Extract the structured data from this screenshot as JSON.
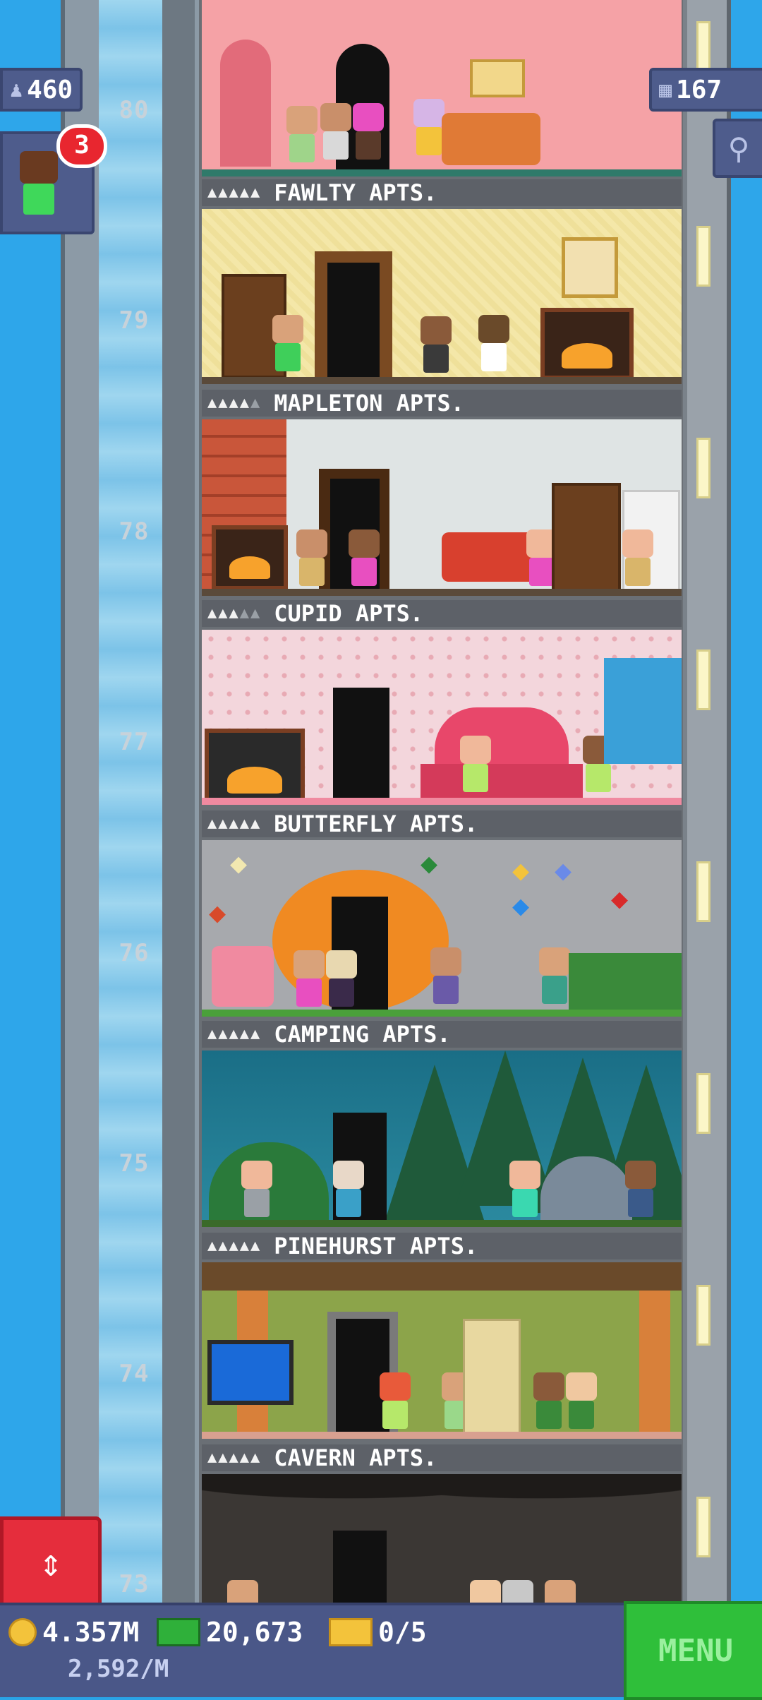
{
  "hud": {
    "population": "460",
    "floors": "167",
    "notification_count": "3"
  },
  "shaft": {
    "floor_numbers": [
      "80",
      "79",
      "78",
      "77",
      "76",
      "75",
      "74",
      "73"
    ]
  },
  "floors": [
    {
      "label": "FAWLTY APTS.",
      "stars_on": 5
    },
    {
      "label": "MAPLETON APTS.",
      "stars_on": 4
    },
    {
      "label": "CUPID APTS.",
      "stars_on": 3
    },
    {
      "label": "BUTTERFLY APTS.",
      "stars_on": 5
    },
    {
      "label": "CAMPING APTS.",
      "stars_on": 5
    },
    {
      "label": "PINEHURST APTS.",
      "stars_on": 5
    },
    {
      "label": "CAVERN APTS.",
      "stars_on": 5
    }
  ],
  "bottom": {
    "coins": "4.357M",
    "coins_rate": "2,592/M",
    "bux": "20,673",
    "tickets": "0/5",
    "menu_label": "MENU"
  },
  "icons": [
    "person-icon",
    "floors-grid-icon",
    "magnifier-icon",
    "coin-icon",
    "bux-icon",
    "ticket-icon",
    "elevator-arrows-icon"
  ],
  "colors": {
    "hud_bg": "#4e5c8c",
    "menu_green": "#2fbf3a",
    "elevator_red": "#e52d3c",
    "badge_red": "#e8262f"
  }
}
